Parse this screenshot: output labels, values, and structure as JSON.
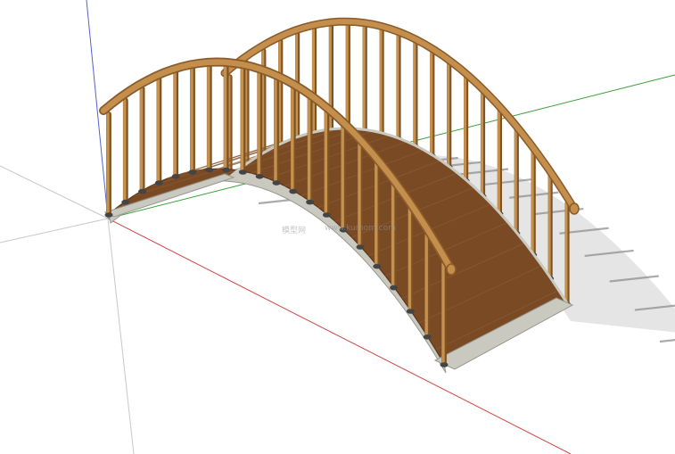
{
  "scene": {
    "subject": "arched wooden footbridge",
    "view": "3D modelling viewport, isometric perspective",
    "background": "#ffffff"
  },
  "axes": {
    "red": "#d04545",
    "green": "#3aa03a",
    "blue": "#5560d8",
    "guide": "#c8c8c8"
  },
  "colors": {
    "deck": "#7a4a25",
    "deck_dark": "#5e3518",
    "plank_line": "#8a5a33",
    "rail": "#c48e4c",
    "rail_dark": "#8a5a28",
    "post": "#c4914e",
    "post_dark": "#7e5222",
    "stone": "#c9c9c0",
    "stone_dark": "#98988e",
    "base": "#444444",
    "shadow": "#b5b5b5"
  },
  "watermark": {
    "text_1": "模型网",
    "text_2": "www.kumom.com"
  }
}
